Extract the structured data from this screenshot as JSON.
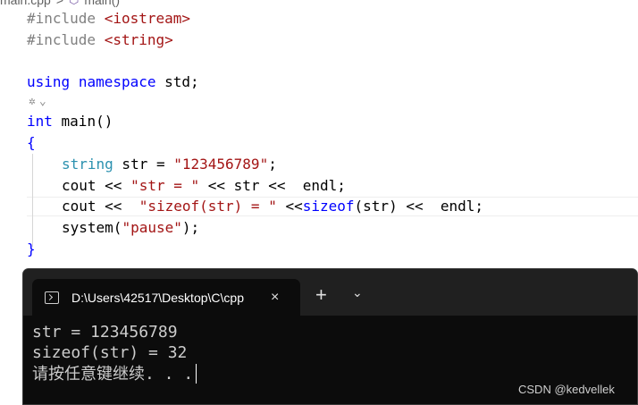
{
  "editor": {
    "breadcrumb": {
      "file": "main.cpp",
      "separator": ">",
      "symbol_icon": "cube-icon",
      "symbol": "main()"
    },
    "codelens_icon": "code-analysis-icon",
    "code": {
      "l1_directive": "#include ",
      "l1_header": "<iostream>",
      "l2_directive": "#include ",
      "l2_header": "<string>",
      "l4_using": "using",
      "l4_namespace": "namespace",
      "l4_rest": " std;",
      "l6_int": "int",
      "l6_rest": " main()",
      "l7": "{",
      "l8_type": "string",
      "l8_mid": " str = ",
      "l8_str": "\"123456789\"",
      "l8_end": ";",
      "l9_a": "cout << ",
      "l9_str": "\"str = \"",
      "l9_b": " << str <<  endl;",
      "l10_a": "cout <<  ",
      "l10_str": "\"sizeof(str) = \"",
      "l10_b": " <<",
      "l10_kw": "sizeof",
      "l10_c": "(str) <<  endl;",
      "l11_a": "system(",
      "l11_str": "\"pause\"",
      "l11_b": ");",
      "l12": "}"
    }
  },
  "terminal": {
    "tab_icon": "terminal-icon",
    "tab_title": "D:\\Users\\42517\\Desktop\\C\\cpp",
    "close_icon": "×",
    "new_tab_icon": "+",
    "dropdown_icon": "⌄",
    "output": [
      "str = 123456789",
      "sizeof(str) = 32",
      "请按任意键继续. . ."
    ]
  },
  "watermark": "CSDN @kedvellek",
  "colors": {
    "keyword": "#0000ff",
    "string": "#a31515",
    "type": "#2b91af",
    "terminal_bg": "#0c0c0c",
    "tabbar_bg": "#202020"
  }
}
